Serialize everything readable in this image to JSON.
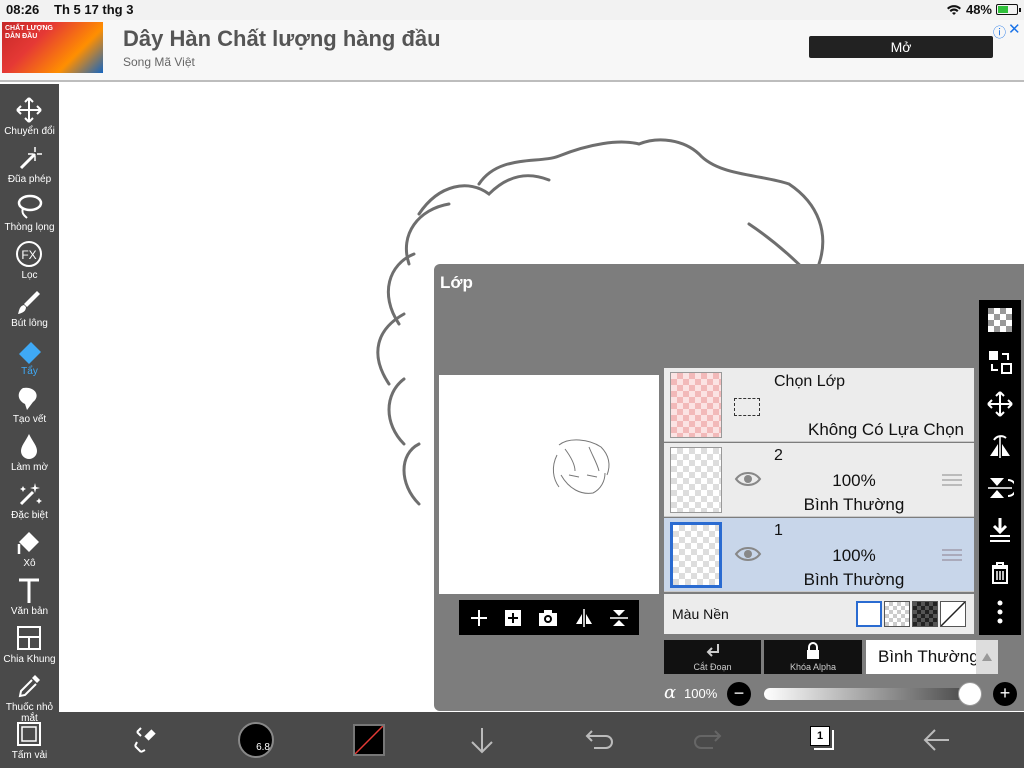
{
  "status_bar": {
    "time": "08:26",
    "date": "Th 5 17 thg 3",
    "battery": "48%",
    "battery_level": 48
  },
  "ad": {
    "thumb_text": "CHẤT LƯỢNG DẪN ĐẦU",
    "title": "Dây Hàn Chất lượng hàng đầu",
    "subtitle": "Song Mã Việt",
    "open_button": "Mở",
    "info_icon": "info-icon",
    "close_icon": "close-icon"
  },
  "tools": [
    {
      "label": "Chuyển đổi",
      "icon": "move-icon"
    },
    {
      "label": "Đũa phép",
      "icon": "magic-wand-icon"
    },
    {
      "label": "Thòng lọng",
      "icon": "lasso-icon"
    },
    {
      "label": "Lọc",
      "icon": "fx-icon"
    },
    {
      "label": "Bút lông",
      "icon": "brush-icon"
    },
    {
      "label": "Tẩy",
      "icon": "eraser-icon",
      "active": true
    },
    {
      "label": "Tạo vết",
      "icon": "smudge-icon"
    },
    {
      "label": "Làm mờ",
      "icon": "blur-icon"
    },
    {
      "label": "Đặc biệt",
      "icon": "special-icon"
    },
    {
      "label": "Xô",
      "icon": "bucket-icon"
    },
    {
      "label": "Văn bản",
      "icon": "text-icon"
    },
    {
      "label": "Chia Khung",
      "icon": "frame-divider-icon"
    },
    {
      "label": "Thuốc nhỏ mắt",
      "icon": "eyedropper-icon"
    },
    {
      "label": "Tấm vải",
      "icon": "canvas-icon"
    }
  ],
  "layer_panel": {
    "title": "Lớp",
    "selection_layer": {
      "title": "Chọn Lớp",
      "subtitle": "Không Có Lựa Chọn"
    },
    "layers": [
      {
        "number": "2",
        "opacity": "100%",
        "blend": "Bình Thường",
        "selected": false
      },
      {
        "number": "1",
        "opacity": "100%",
        "blend": "Bình Thường",
        "selected": true
      }
    ],
    "background_label": "Màu Nền",
    "clipping_label": "Cắt Đoạn",
    "alpha_lock_label": "Khóa Alpha",
    "blend_mode": "Bình Thường",
    "alpha_symbol": "α",
    "opacity_value": "100%",
    "opacity_level": 1.0,
    "minus": "−",
    "plus": "+"
  },
  "bottom_bar": {
    "brush_size": "6.8",
    "page_count": "1"
  },
  "colors": {
    "toolbar_bg": "#4a4a4a",
    "active_tool": "#3fa9f5",
    "selected_layer": "#c8d6ea",
    "panel_bg": "#7d7d7d"
  }
}
